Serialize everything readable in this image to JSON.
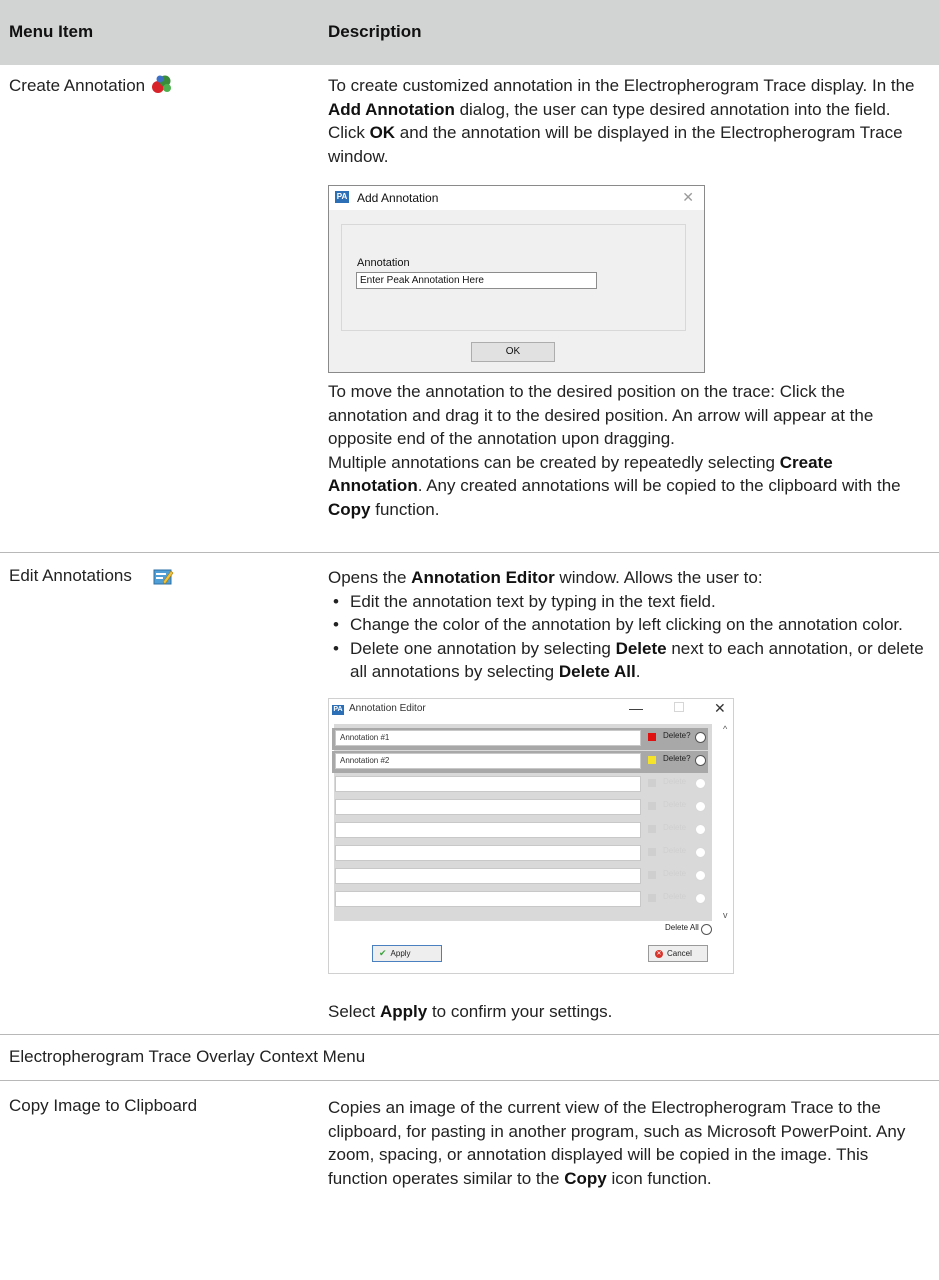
{
  "table": {
    "header": {
      "menu_item": "Menu Item",
      "description": "Description"
    },
    "rows": [
      {
        "label": "Create Annotation",
        "icon": "annotation-create-icon",
        "p1_a": "To create customized annotation in the Electropherogram Trace display. In the ",
        "p1_b": "Add Annotation",
        "p1_c": " dialog, the user can type desired annotation into the field. Click ",
        "p1_d": "OK",
        "p1_e": " and the annotation will be displayed in the Electropherogram Trace window.",
        "p2": "To move the annotation to the desired position on the trace: Click the annotation and drag it to the desired position. An arrow will appear at the opposite end of the annotation upon dragging.",
        "p3_a": "Multiple annotations can be created by repeatedly selecting ",
        "p3_b": "Create Annotation",
        "p3_c": ". Any created annotations will be copied to the clipboard with the ",
        "p3_d": "Copy",
        "p3_e": " function."
      },
      {
        "label": "Edit Annotations",
        "icon": "annotation-edit-icon",
        "intro_a": "Opens the ",
        "intro_b": "Annotation Editor",
        "intro_c": " window. Allows the user to:",
        "bullet1": "Edit the annotation text by typing in the text field.",
        "bullet2": "Change the color of the annotation by left clicking on the annotation color.",
        "bullet3_a": "Delete one annotation by selecting ",
        "bullet3_b": "Delete",
        "bullet3_c": " next to each annotation, or delete all annotations by selecting ",
        "bullet3_d": "Delete All",
        "bullet3_e": ".",
        "outro_a": "Select ",
        "outro_b": "Apply",
        "outro_c": " to confirm your settings."
      }
    ],
    "section_label": "Electropherogram Trace Overlay Context Menu",
    "copy_row": {
      "label": "Copy Image to Clipboard",
      "desc_a": "Copies an image of the current view of the Electropherogram Trace to the clipboard, for pasting in another program, such as Microsoft PowerPoint. Any zoom, spacing, or annotation displayed will be copied in the image. This function operates similar to the ",
      "desc_b": "Copy",
      "desc_c": " icon function."
    }
  },
  "add_annotation_dialog": {
    "title": "Add Annotation",
    "close": "✕",
    "field_label": "Annotation",
    "field_value": "Enter Peak Annotation Here",
    "ok_label": "OK"
  },
  "annotation_editor": {
    "title": "Annotation Editor",
    "minimize": "—",
    "close": "✕",
    "rows": [
      {
        "text": "Annotation #1",
        "swatch": "#e01010",
        "delete_label": "Delete?",
        "enabled": true
      },
      {
        "text": "Annotation #2",
        "swatch": "#f5e32a",
        "delete_label": "Delete?",
        "enabled": true
      },
      {
        "text": "",
        "swatch": "#cfcfcf",
        "delete_label": "Delete",
        "enabled": false
      },
      {
        "text": "",
        "swatch": "#cfcfcf",
        "delete_label": "Delete",
        "enabled": false
      },
      {
        "text": "",
        "swatch": "#cfcfcf",
        "delete_label": "Delete",
        "enabled": false
      },
      {
        "text": "",
        "swatch": "#cfcfcf",
        "delete_label": "Delete",
        "enabled": false
      },
      {
        "text": "",
        "swatch": "#cfcfcf",
        "delete_label": "Delete",
        "enabled": false
      },
      {
        "text": "",
        "swatch": "#cfcfcf",
        "delete_label": "Delete",
        "enabled": false
      }
    ],
    "delete_all_label": "Delete All",
    "apply_label": "Apply",
    "cancel_label": "Cancel",
    "scroll_up": "^",
    "scroll_down": "v"
  }
}
